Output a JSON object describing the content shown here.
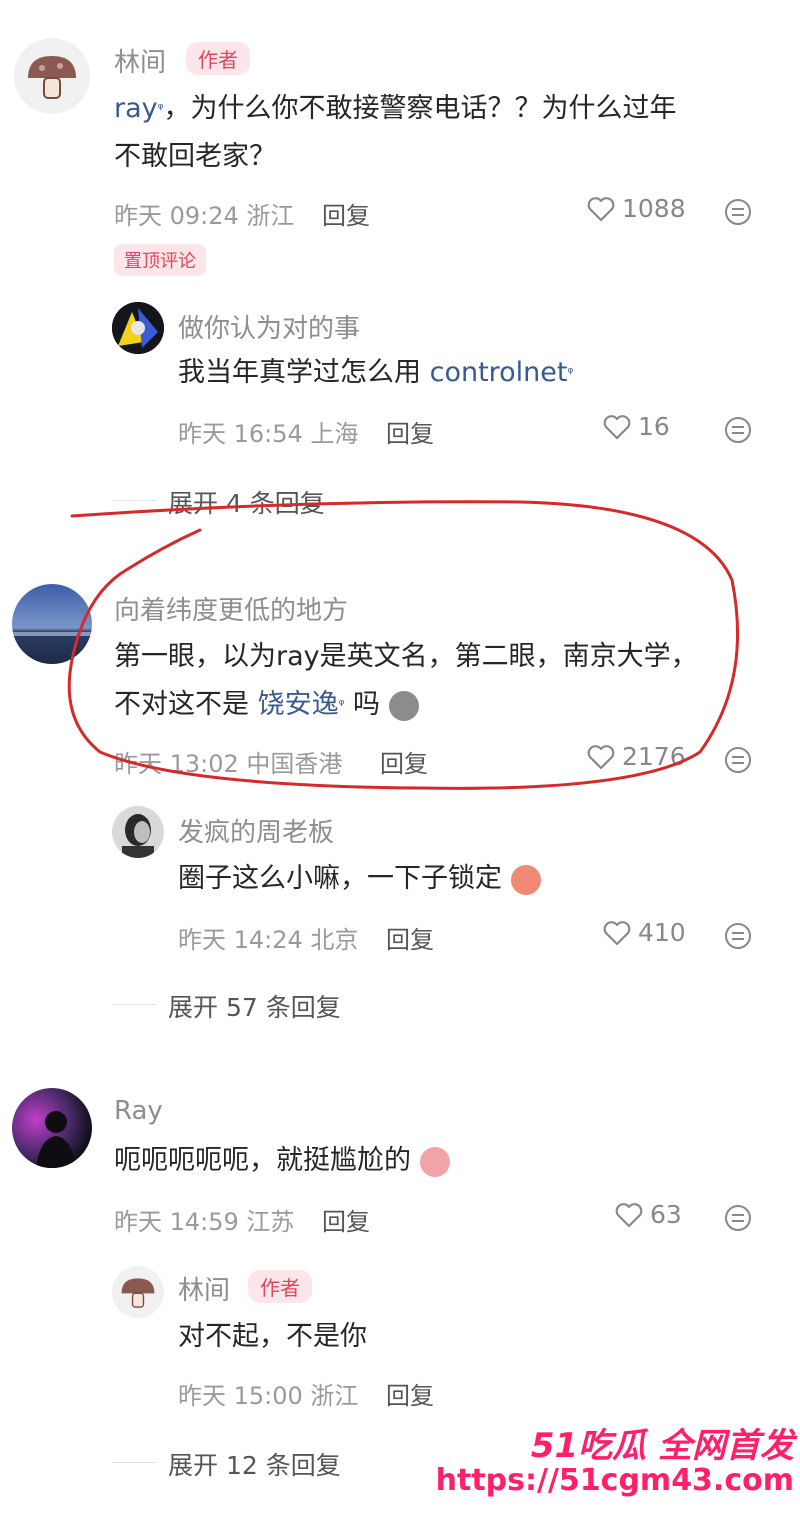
{
  "comments": [
    {
      "name": "林间",
      "badge": "作者",
      "mention": "ray",
      "text_line1": "，为什么你不敢接警察电话？？为什么过年",
      "text_line2": "不敢回老家？",
      "time_location": "昨天 09:24 浙江",
      "reply_label": "回复",
      "likes": "1088",
      "pinned_label": "置顶评论",
      "replies": [
        {
          "name": "做你认为对的事",
          "text": "我当年真学过怎么用 ",
          "link": "controlnet",
          "time_location": "昨天 16:54 上海",
          "reply_label": "回复",
          "likes": "16"
        }
      ],
      "expand_label": "展开 4 条回复"
    },
    {
      "name": "向着纬度更低的地方",
      "text_line1": "第一眼，以为ray是英文名，第二眼，南京大学，",
      "text_line2_prefix": "不对这不是 ",
      "link": "饶安逸",
      "text_line2_suffix": " 吗",
      "time_location": "昨天 13:02 中国香港",
      "reply_label": "回复",
      "likes": "2176",
      "replies": [
        {
          "name": "发疯的周老板",
          "text": "圈子这么小嘛，一下子锁定",
          "time_location": "昨天 14:24 北京",
          "reply_label": "回复",
          "likes": "410"
        }
      ],
      "expand_label": "展开 57 条回复"
    },
    {
      "name": "Ray",
      "text": "呃呃呃呃呃，就挺尴尬的",
      "time_location": "昨天 14:59 江苏",
      "reply_label": "回复",
      "likes": "63",
      "replies": [
        {
          "name": "林间",
          "badge": "作者",
          "text": "对不起，不是你",
          "time_location": "昨天 15:00 浙江",
          "reply_label": "回复"
        }
      ],
      "expand_label": "展开 12 条回复"
    }
  ],
  "watermark": {
    "line1": "51吃瓜 全网首发",
    "line2": "https://51cgm43.com"
  },
  "colors": {
    "author_badge": "#e0475f",
    "link": "#3a5a8c",
    "annotation_red": "#d42a2a",
    "watermark": "#ff1f6b"
  },
  "icons": [
    "heart-icon",
    "more-icon",
    "search-link-icon",
    "mushroom-avatar-icon"
  ]
}
